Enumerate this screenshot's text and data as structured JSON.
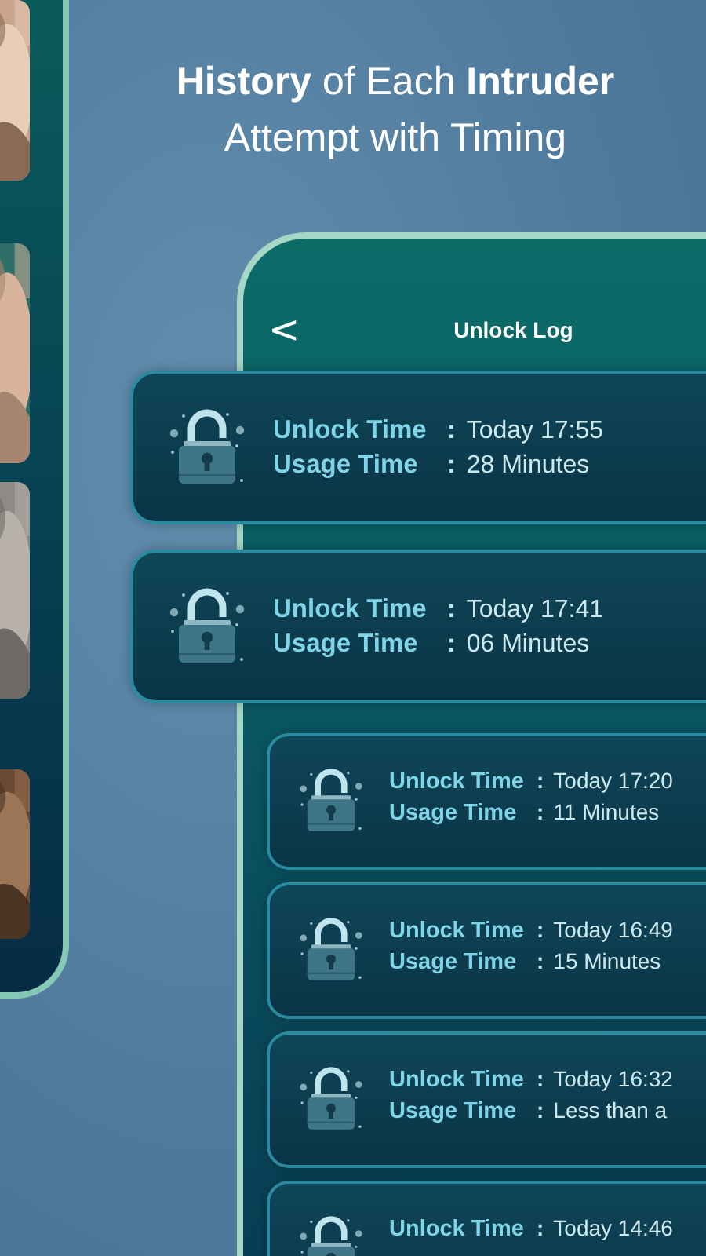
{
  "headline": "**History** of Each **Intruder** Attempt with Timing",
  "screen": {
    "back": "<",
    "title": "Unlock Log"
  },
  "entries": [
    {
      "kind": "large",
      "rows": [
        {
          "label": "Unlock Time",
          "sep": ":",
          "value": "Today 17:55"
        },
        {
          "label": "Usage Time",
          "sep": ":",
          "value": "28 Minutes"
        }
      ]
    },
    {
      "kind": "large",
      "rows": [
        {
          "label": "Unlock Time",
          "sep": ":",
          "value": "Today 17:41"
        },
        {
          "label": "Usage Time",
          "sep": ":",
          "value": "06 Minutes"
        }
      ]
    },
    {
      "kind": "small",
      "rows": [
        {
          "label": "Unlock Time",
          "sep": ":",
          "value": "Today 17:20"
        },
        {
          "label": "Usage Time",
          "sep": ":",
          "value": "11 Minutes"
        }
      ]
    },
    {
      "kind": "small",
      "rows": [
        {
          "label": "Unlock Time",
          "sep": ":",
          "value": "Today 16:49"
        },
        {
          "label": "Usage Time",
          "sep": ":",
          "value": "15 Minutes"
        }
      ]
    },
    {
      "kind": "small",
      "rows": [
        {
          "label": "Unlock Time",
          "sep": ":",
          "value": "Today 16:32"
        },
        {
          "label": "Usage Time",
          "sep": ":",
          "value": "Less than a"
        }
      ]
    },
    {
      "kind": "small",
      "rows": [
        {
          "label": "Unlock Time",
          "sep": ":",
          "value": "Today 14:46"
        }
      ]
    }
  ]
}
